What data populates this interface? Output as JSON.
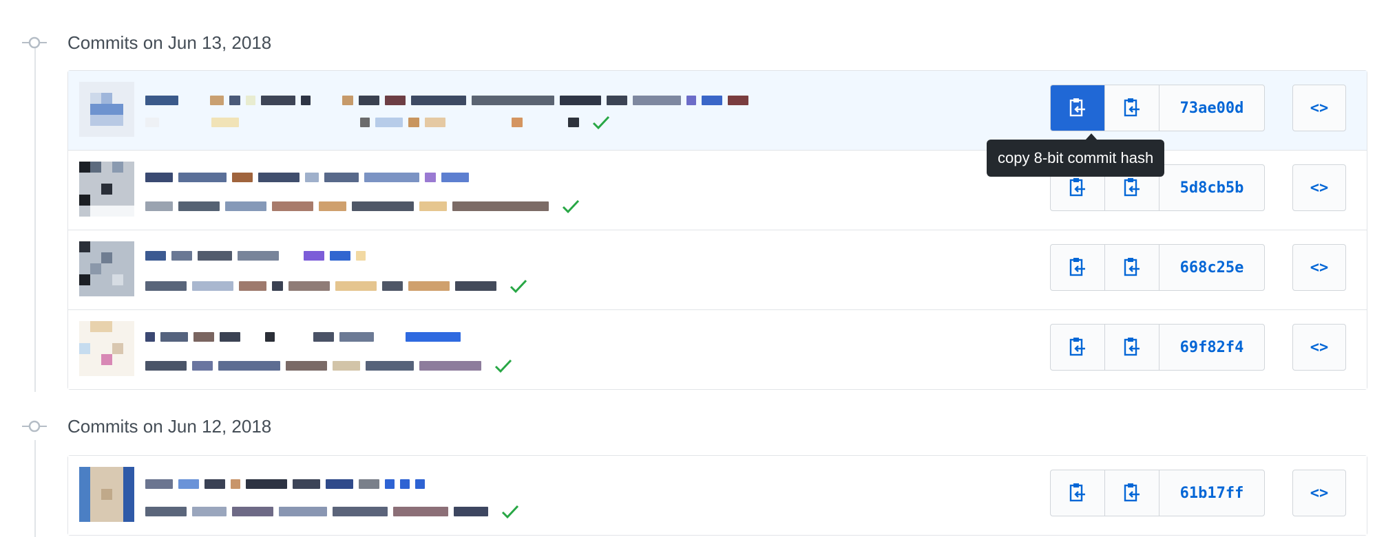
{
  "groups": [
    {
      "title": "Commits on Jun 13, 2018",
      "commits": [
        {
          "sha": "73ae00d",
          "highlighted": true,
          "verified": true
        },
        {
          "sha": "5d8cb5b",
          "highlighted": false,
          "verified": true
        },
        {
          "sha": "668c25e",
          "highlighted": false,
          "verified": true
        },
        {
          "sha": "69f82f4",
          "highlighted": false,
          "verified": true
        }
      ]
    },
    {
      "title": "Commits on Jun 12, 2018",
      "commits": [
        {
          "sha": "61b17ff",
          "highlighted": false,
          "verified": true
        }
      ]
    }
  ],
  "tooltip": {
    "text": "copy 8-bit commit hash"
  },
  "browse_label": "<>",
  "icons": {
    "copy_button_1": "clipboard-copy-icon",
    "copy_button_2": "clipboard-copy-icon",
    "browse": "code-icon",
    "timeline": "git-commit-icon",
    "status": "check-icon"
  },
  "colors": {
    "accent": "#0366d6",
    "active_button": "#2068d6",
    "check": "#28a745",
    "tooltip_bg": "#24292e",
    "highlight_row": "#f1f8ff"
  }
}
